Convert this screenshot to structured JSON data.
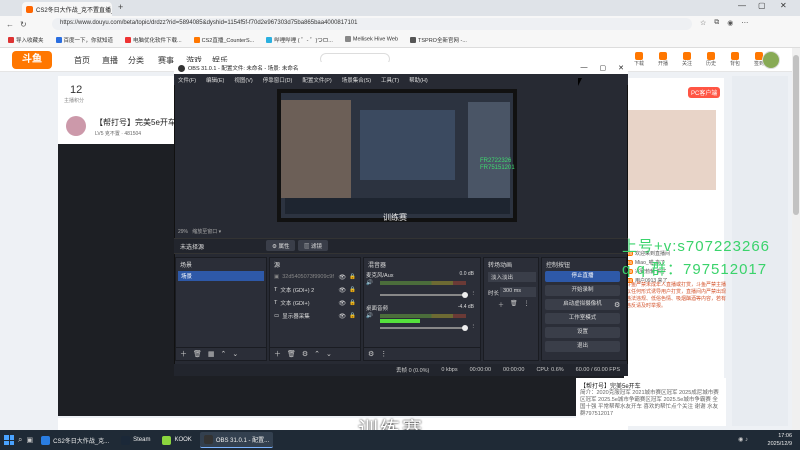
{
  "browser": {
    "tab_title": "CS2冬日大作战_克不置直播_虎牙斗",
    "url": "https://www.douyu.com/beta/topic/drdzz?rid=5894085&dyshid=1154f5f-f70d2e967303d75ba865baa4000817101",
    "new_tab": "+",
    "bookmarks": [
      {
        "label": "导入收藏夹",
        "color": "#d33"
      },
      {
        "label": "百度一下，你就知道",
        "color": "#2a6ee0"
      },
      {
        "label": "电脑优化软件下载...",
        "color": "#e33"
      },
      {
        "label": "CS2直播_CounterS...",
        "color": "#f70"
      },
      {
        "label": "哔哩哔哩 ( ゜- ゜)つロ...",
        "color": "#2ab0e0"
      },
      {
        "label": "Mellisek Hive Web",
        "color": "#888"
      },
      {
        "label": "TSPRO全新官网 -...",
        "color": "#555"
      }
    ]
  },
  "site": {
    "logo": "斗鱼",
    "nav": [
      "首页",
      "直播",
      "分类",
      "赛事",
      "游戏",
      "娱乐"
    ],
    "right_icons": [
      "下载",
      "开播",
      "关注",
      "历史",
      "背包",
      "签到"
    ],
    "stat_number": "12",
    "stat_label": "主播积分",
    "stream_title": "【帮打号】完美5e开车",
    "stream_meta": "LV5 克不置 · 481504",
    "pc_badge": "PC客户端",
    "chat": [
      {
        "badge": "28",
        "text": "欢迎来到直播间"
      },
      {
        "badge": "26",
        "text": "Miao_喵 来了"
      },
      {
        "badge": "29",
        "text": "兴致勃勃 来了"
      },
      {
        "badge": "28",
        "text": "用户0913 来了"
      }
    ],
    "chat_notice": "斗鱼严禁未成年人直播或打赏，斗鱼严禁主播以任何形式诱导用户打赏，直播间内严禁出现违法违规、低俗色情、吸烟酗酒等内容，若有违反请及时举报。",
    "article_title": "【帮打号】完美5e开车",
    "article_body": "简介：2020克服冠军 2021城市赛区冠军 2025成尼城市赛区冠军 2025.5e城市争霸赛区冠军 2025.5e城市争霸赛 全国十强 平常帮帮水友开车 喜欢的帮忙点个关注 谢谢 水友群797512017"
  },
  "obs": {
    "title": "OBS 31.0.1 - 配置文件: 未命名 - 场景: 未命名",
    "menu": [
      "文件(F)",
      "编辑(E)",
      "视图(V)",
      "停靠窗口(D)",
      "配置文件(P)",
      "场景集合(S)",
      "工具(T)",
      "帮助(H)"
    ],
    "preview_label": "训练赛",
    "preview_green": "FR2722326\nFR75151201",
    "zoom": "29%",
    "zoom_mode": "缩放至窗口",
    "no_source": "未选择源",
    "props_btn": "⚙ 属性",
    "filter_btn": "▥ 滤镜",
    "docks": {
      "scenes": "场景",
      "sources": "源",
      "mixer": "混音器",
      "transitions": "转场动画",
      "controls": "控制按钮"
    },
    "scene_items": [
      "场景"
    ],
    "sources": [
      {
        "name": "32d5405073f9909c9f",
        "icon": "▣",
        "dim": true
      },
      {
        "name": "文本 (GDI+) 2",
        "icon": "T"
      },
      {
        "name": "文本 (GDI+)",
        "icon": "T"
      },
      {
        "name": "显示器采集",
        "icon": "▭"
      }
    ],
    "mixer": [
      {
        "name": "麦克风/Aux",
        "db": "0.0 dB",
        "level": 0.0
      },
      {
        "name": "桌面音频",
        "db": "-4.4 dB",
        "level": 0.46
      }
    ],
    "transition": "淡入淡出",
    "duration_label": "时长",
    "duration": "300 ms",
    "controls": [
      "停止直播",
      "开始录制",
      "启动虚拟摄像机",
      "工作室模式",
      "设置",
      "退出"
    ],
    "status": [
      "丢帧 0 (0.0%)",
      "0 kbps",
      "00:00:00",
      "00:00:00",
      "CPU: 0.6%",
      "60.00 / 60.00 FPS"
    ]
  },
  "overlay": {
    "line1": "上号+v:s707223266",
    "line2": "q q 群：797512017",
    "subtitle": "训练赛"
  },
  "taskbar": {
    "items": [
      {
        "label": "CS2冬日大作战_克...",
        "color": "#2a7de1",
        "active": false
      },
      {
        "label": "Steam",
        "color": "#1b2838",
        "active": false
      },
      {
        "label": "KOOK",
        "color": "#8bd53e",
        "active": false
      },
      {
        "label": "OBS 31.0.1 - 配置...",
        "color": "#333",
        "active": true
      }
    ],
    "time": "17:06",
    "date": "2025/12/9"
  }
}
